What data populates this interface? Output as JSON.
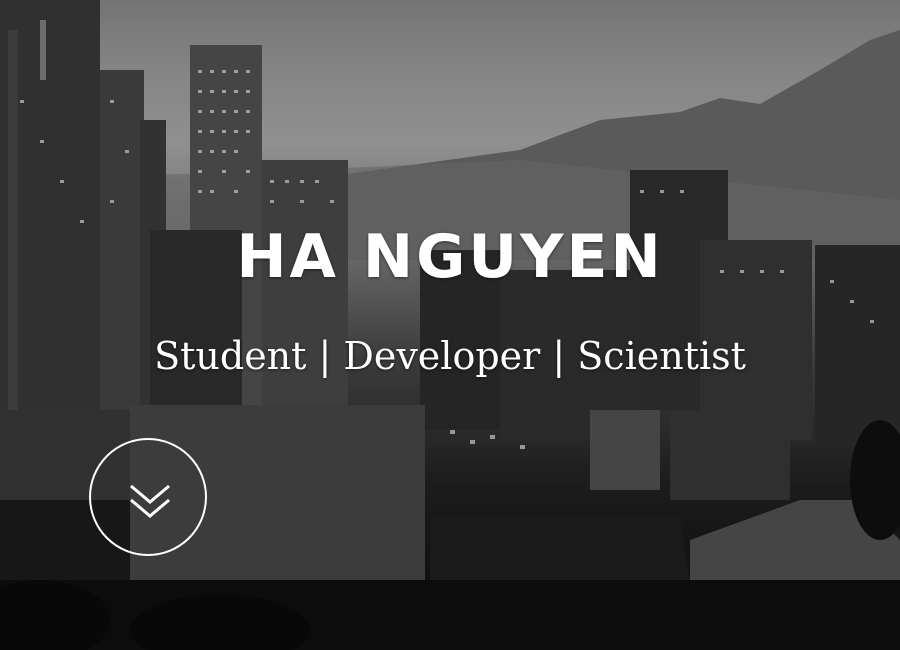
{
  "hero": {
    "name": "HA NGUYEN",
    "tagline": "Student | Developer | Scientist",
    "background_image": "grayscale-city-skyline-with-mountain",
    "scroll_button_icon": "double-chevron-down-icon",
    "text_color": "#ffffff"
  }
}
